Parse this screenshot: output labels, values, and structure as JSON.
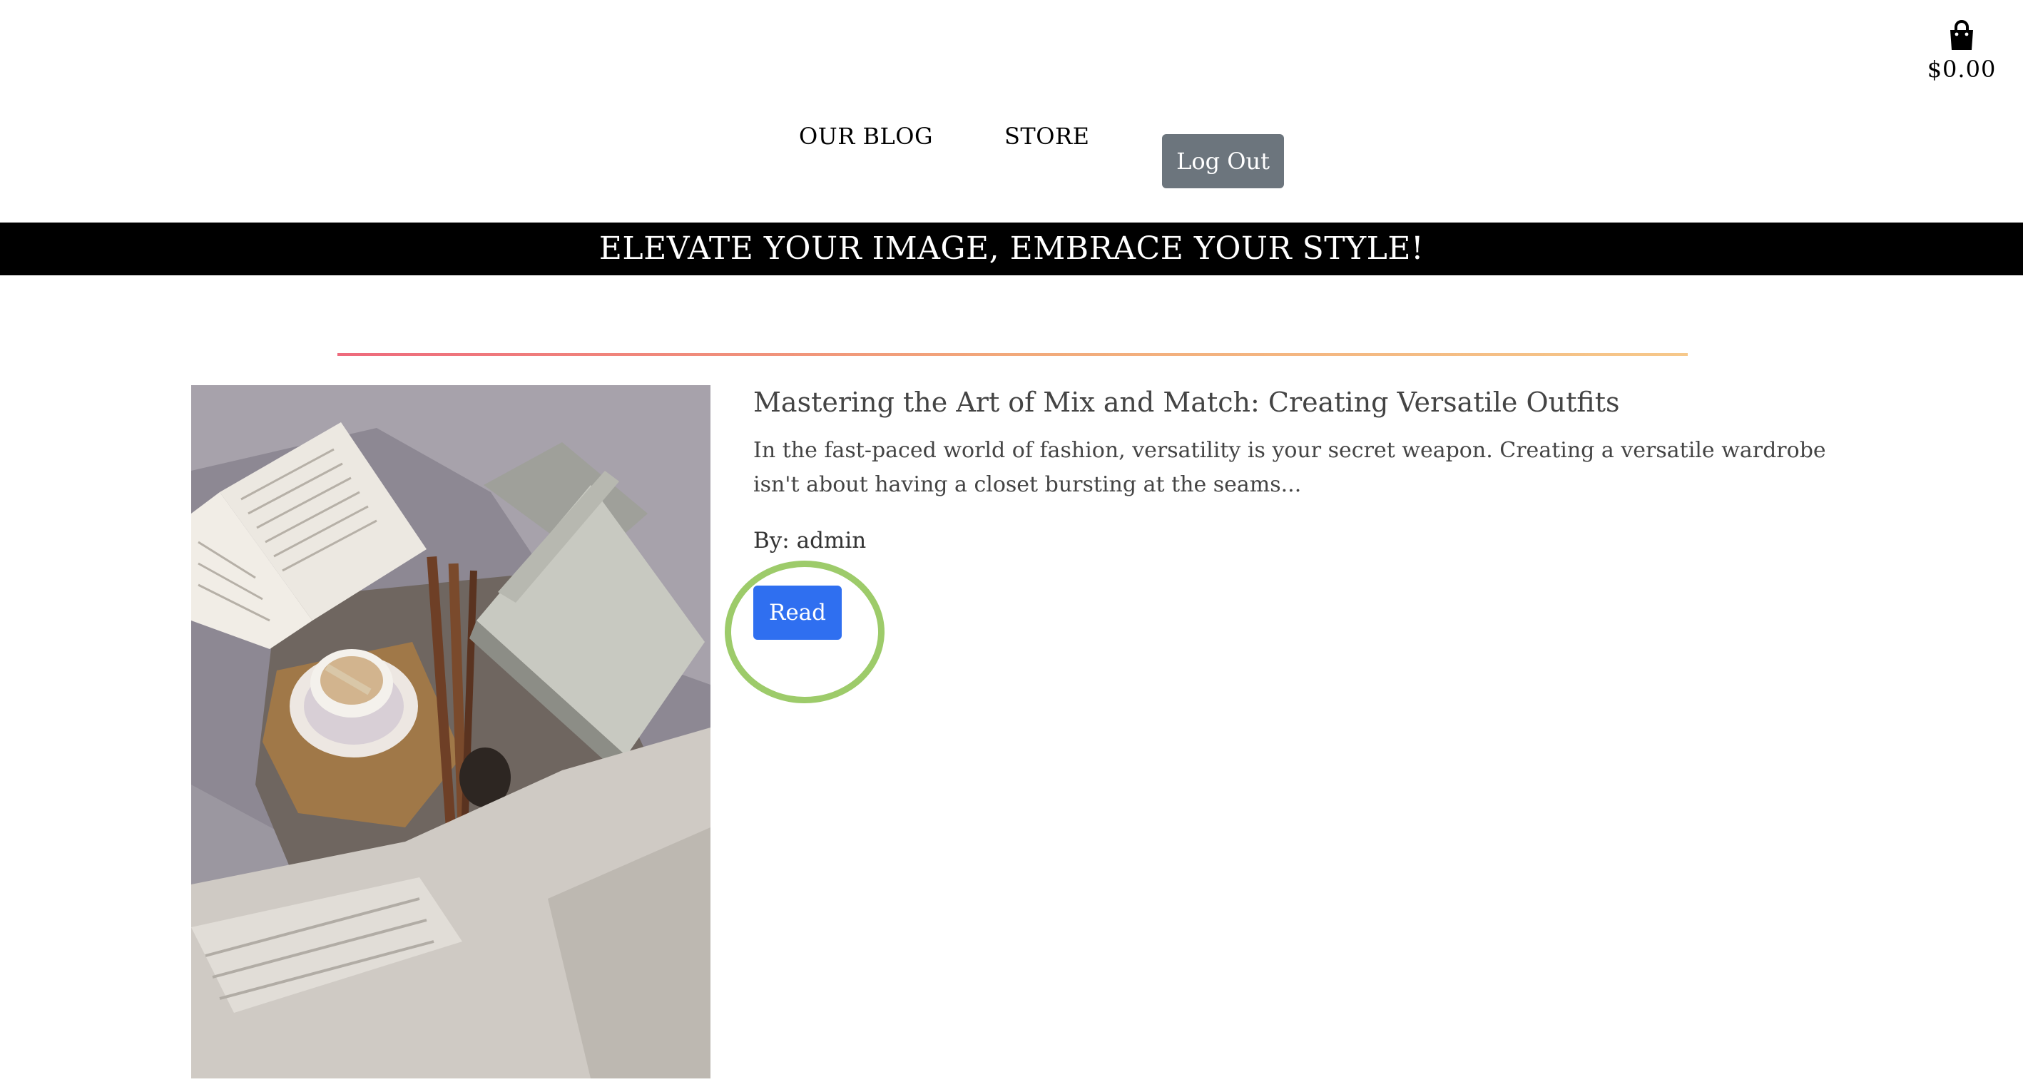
{
  "header": {
    "cart": {
      "icon": "shopping-bag-icon",
      "total": "$0.00"
    },
    "nav": {
      "blog_label": "OUR BLOG",
      "store_label": "STORE",
      "logout_label": "Log Out"
    }
  },
  "banner": {
    "text": "ELEVATE YOUR IMAGE, EMBRACE YOUR STYLE!"
  },
  "post": {
    "title": "Mastering the Art of Mix and Match: Creating Versatile Outfits",
    "excerpt": "In the fast-paced world of fashion, versatility is your secret weapon. Creating a versatile wardrobe isn't about having a closet bursting at the seams...",
    "author": "By: admin",
    "read_label": "Read"
  },
  "colors": {
    "banner_bg": "#000000",
    "logout_bg": "#6c757d",
    "read_bg": "#2f6ff0",
    "highlight_ring": "#9dcb6a",
    "divider_start": "#ee6a7c",
    "divider_end": "#f6c88a"
  }
}
